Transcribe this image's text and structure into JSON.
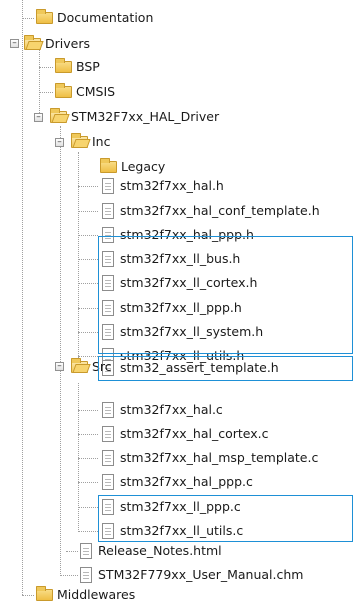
{
  "tree": {
    "documentation": "Documentation",
    "drivers": "Drivers",
    "bsp": "BSP",
    "cmsis": "CMSIS",
    "hal_driver": "STM32F7xx_HAL_Driver",
    "inc": "Inc",
    "legacy": "Legacy",
    "inc_files": [
      "stm32f7xx_hal.h",
      "stm32f7xx_hal_conf_template.h",
      "stm32f7xx_hal_ppp.h",
      "stm32f7xx_ll_bus.h",
      "stm32f7xx_ll_cortex.h",
      "stm32f7xx_ll_ppp.h",
      "stm32f7xx_ll_system.h",
      "stm32f7xx_ll_utils.h",
      "stm32_assert_template.h"
    ],
    "src": "Src",
    "src_files": [
      "stm32f7xx_hal.c",
      "stm32f7xx_hal_cortex.c",
      "stm32f7xx_hal_msp_template.c",
      "stm32f7xx_hal_ppp.c",
      "stm32f7xx_ll_ppp.c",
      "stm32f7xx_ll_utils.c"
    ],
    "release_notes": "Release_Notes.html",
    "user_manual": "STM32F779xx_User_Manual.chm",
    "middlewares": "Middlewares"
  },
  "colors": {
    "highlight_border": "#1e90d6",
    "folder": "#efbe45"
  }
}
